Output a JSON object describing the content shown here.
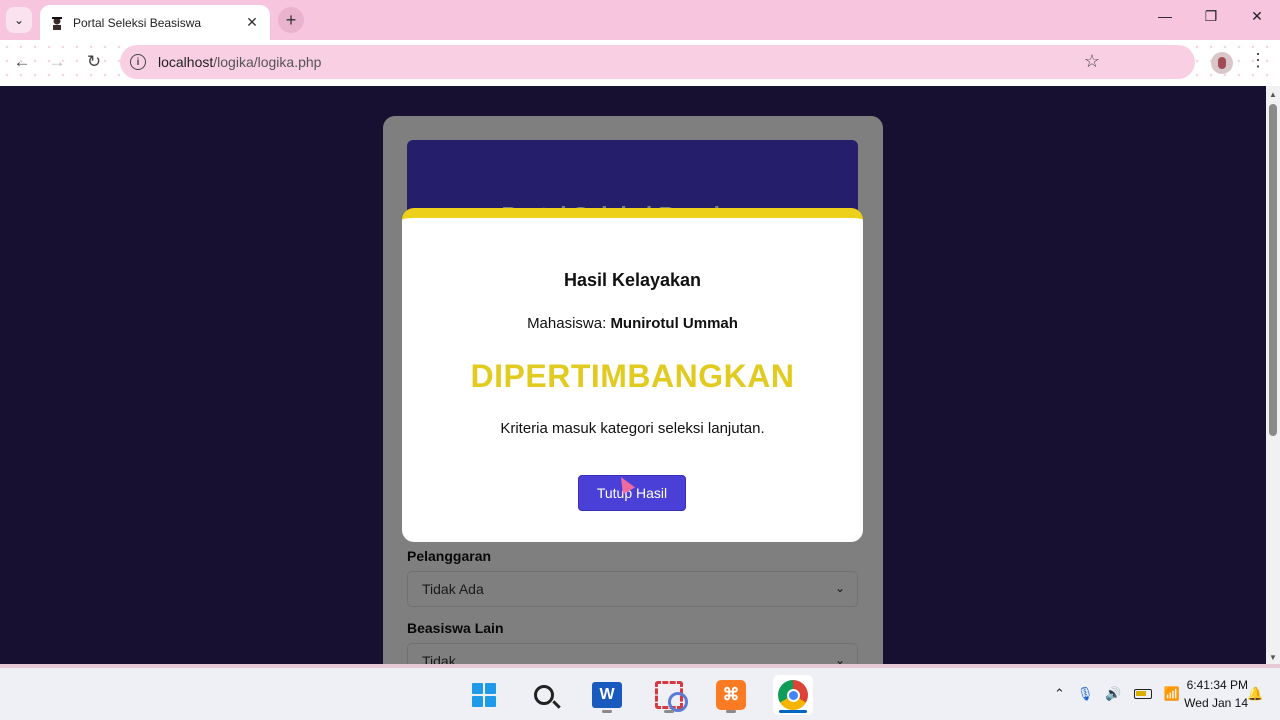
{
  "browser": {
    "tab_title": "Portal Seleksi Beasiswa",
    "tab_close": "✕",
    "new_tab": "+",
    "url_host": "localhost",
    "url_path": "/logika/logika.php",
    "minimize": "—",
    "maximize": "❐",
    "close": "✕",
    "back": "←",
    "forward": "→",
    "reload": "↻",
    "bookmark": "☆",
    "menu": "⋮",
    "tab_search": "⌄"
  },
  "page": {
    "header_title": "Portal Seleksi Beasiswa",
    "fields": [
      {
        "label": "Pelanggaran",
        "value": "Tidak Ada"
      },
      {
        "label": "Beasiswa Lain",
        "value": "Tidak"
      }
    ]
  },
  "modal": {
    "title": "Hasil Kelayakan",
    "student_prefix": "Mahasiswa:",
    "student_name": "Munirotul Ummah",
    "status": "DIPERTIMBANGKAN",
    "description": "Kriteria masuk kategori seleksi lanjutan.",
    "button_label": "Tutup Hasil",
    "accent_color": "#ecd01a",
    "status_color": "#e2cb21",
    "button_color": "#4a3fd6"
  },
  "taskbar": {
    "apps": [
      "windows-start",
      "search",
      "microsoft-word",
      "snipping-tool",
      "xampp",
      "google-chrome"
    ],
    "active_app": "google-chrome",
    "time": "6:41:34 PM",
    "date": "Wed Jan 14"
  }
}
